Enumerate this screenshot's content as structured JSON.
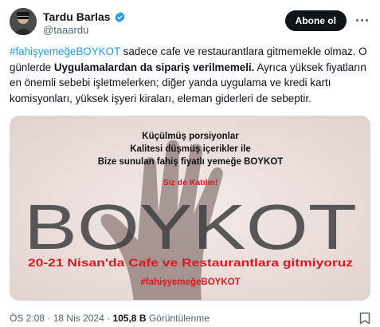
{
  "author": {
    "display_name": "Tardu Barlas",
    "handle": "@taaardu",
    "verified": true
  },
  "follow_label": "Abone ol",
  "tweet": {
    "segments": [
      {
        "text": "#fahişyemeğeBOYKOT",
        "style": "hashtag"
      },
      {
        "text": " sadece cafe ve restaurantlara gitmemekle olmaz. O günlerde ",
        "style": "normal"
      },
      {
        "text": "Uygulamalardan da sipariş verilmemeli.",
        "style": "bold"
      },
      {
        "text": " Ayrıca yüksek fiyatların en önemli sebebi işletmelerken; diğer yanda uygulama ve kredi kartı komisyonları, yüksek işyeri kiraları, eleman giderleri de sebeptir.",
        "style": "normal"
      }
    ]
  },
  "image": {
    "line1": "Küçülmüş porsiyonlar",
    "line2": "Kalitesi düşmüş içerikler ile",
    "line3": "Bize sunulan fahiş fiyatlı yemeğe BOYKOT",
    "join": "Siz de Katılın!",
    "big_word": "BOYKOT",
    "date_line": "20-21 Nisan'da Cafe ve Restaurantlara gitmiyoruz",
    "hashtag": "#fahişyemeğeBOYKOT",
    "accent_color": "#e0141e",
    "big_word_color": "#3f3f3f",
    "background_color": "#efe6e4"
  },
  "meta": {
    "time": "ÖS 2:08",
    "separator": "·",
    "date": "18 Nis 2024",
    "views_count": "105,8 B",
    "views_label": "Görüntülenme"
  },
  "icons": {
    "verified": "verified-badge-icon",
    "more": "more-dots-icon",
    "bookmark": "bookmark-icon",
    "avatar": "avatar"
  }
}
